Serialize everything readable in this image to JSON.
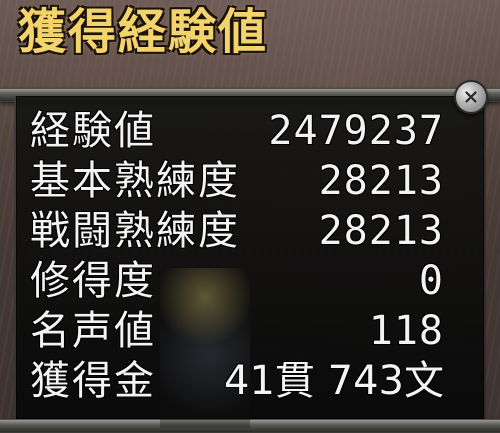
{
  "title": "獲得経験値",
  "close_icon": "close-icon",
  "stats": [
    {
      "label": "経験値",
      "value": "2479237"
    },
    {
      "label": "基本熟練度",
      "value": "28213"
    },
    {
      "label": "戦闘熟練度",
      "value": "28213"
    },
    {
      "label": "修得度",
      "value": "0"
    },
    {
      "label": "名声値",
      "value": "118"
    },
    {
      "label": "獲得金",
      "value": "41貫 743文"
    }
  ],
  "colors": {
    "title": "#f3d36b",
    "text": "#f3f3f3",
    "panel": "#0b0b0a"
  }
}
